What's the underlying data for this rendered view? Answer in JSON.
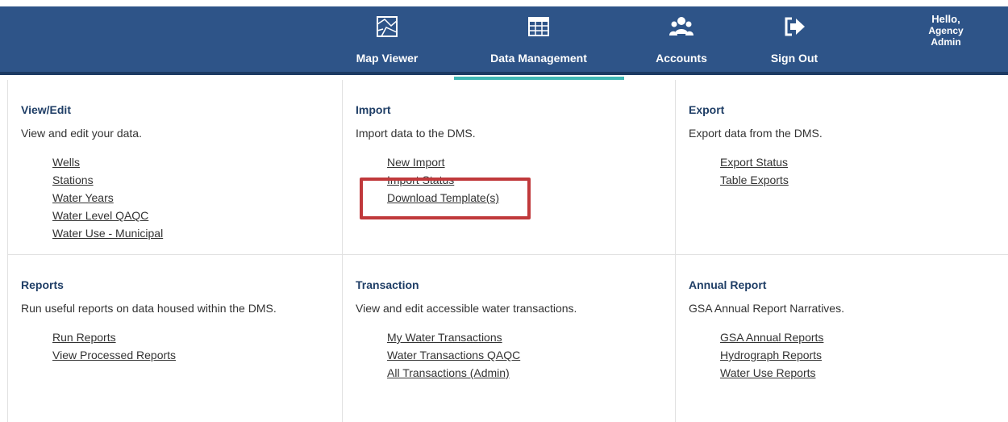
{
  "header": {
    "nav": [
      {
        "label": "Map Viewer",
        "icon": "map-icon"
      },
      {
        "label": "Data Management",
        "icon": "table-icon"
      },
      {
        "label": "Accounts",
        "icon": "users-icon"
      },
      {
        "label": "Sign Out",
        "icon": "sign-out-icon"
      }
    ],
    "greeting_line1": "Hello,",
    "greeting_line2": "Agency",
    "greeting_line3": "Admin",
    "active_tab": "Data Management",
    "colors": {
      "bar": "#2e5488",
      "active_indicator": "#3fb7b5"
    }
  },
  "sections": [
    {
      "title": "View/Edit",
      "description": "View and edit your data.",
      "links": [
        "Wells",
        "Stations",
        "Water Years",
        "Water Level QAQC",
        "Water Use - Municipal"
      ]
    },
    {
      "title": "Import",
      "description": "Import data to the DMS.",
      "links": [
        "New Import",
        "Import Status",
        "Download Template(s)"
      ]
    },
    {
      "title": "Export",
      "description": "Export data from the DMS.",
      "links": [
        "Export Status",
        "Table Exports"
      ]
    },
    {
      "title": "Reports",
      "description": "Run useful reports on data housed within the DMS.",
      "links": [
        "Run Reports",
        "View Processed Reports"
      ]
    },
    {
      "title": "Transaction",
      "description": "View and edit accessible water transactions.",
      "links": [
        "My Water Transactions",
        "Water Transactions QAQC",
        "All Transactions (Admin)"
      ]
    },
    {
      "title": "Annual Report",
      "description": "GSA Annual Report Narratives.",
      "links": [
        "GSA Annual Reports",
        "Hydrograph Reports",
        "Water Use Reports"
      ]
    }
  ]
}
